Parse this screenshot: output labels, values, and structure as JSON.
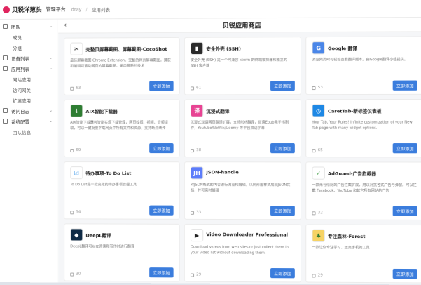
{
  "header": {
    "brand": "贝锐洋葱头",
    "platform": "管理平台",
    "breadcrumb": [
      "dray",
      "应用列表"
    ]
  },
  "sidebar": [
    {
      "label": "团队",
      "type": "group",
      "icon": "team-icon"
    },
    {
      "label": "成员",
      "type": "sub"
    },
    {
      "label": "分组",
      "type": "sub"
    },
    {
      "label": "设备列表",
      "type": "group",
      "icon": "device-icon"
    },
    {
      "label": "应用列表",
      "type": "group",
      "icon": "app-icon"
    },
    {
      "label": "网站应用",
      "type": "sub"
    },
    {
      "label": "访问网关",
      "type": "sub"
    },
    {
      "label": "扩展应用",
      "type": "sub"
    },
    {
      "label": "访问日志",
      "type": "group",
      "icon": "log-icon"
    },
    {
      "label": "系统配置",
      "type": "group",
      "icon": "settings-icon"
    },
    {
      "label": "团队信息",
      "type": "sub"
    }
  ],
  "page": {
    "title": "贝锐应用商店",
    "back": "‹"
  },
  "add_label": "立即添加",
  "apps": [
    {
      "name": "完整页屏幕截图、屏幕截图-CocoShot",
      "desc": "最佳屏幕截图 Chrome Extension。完整的网页屏幕截图。捕获和编辑可滚动网页的屏幕截图。采用最新的技术",
      "users": "63",
      "color": "#ffffff",
      "fg": "#111",
      "glyph": "✂",
      "icon": "scissors-icon"
    },
    {
      "name": "安全外壳 (SSH)",
      "desc": "安全外壳 (SSH) 是一个可兼容 xterm 的终端模拟器和独立的 SSH 客户端",
      "users": "61",
      "color": "#2b2b2b",
      "fg": "#fff",
      "glyph": "▮",
      "icon": "terminal-icon"
    },
    {
      "name": "Google 翻译",
      "desc": "浏览网页时可轻松查看翻译版本。由Google翻译小组提供。",
      "users": "53",
      "color": "#4a86e8",
      "fg": "#fff",
      "glyph": "G",
      "icon": "google-translate-icon"
    },
    {
      "name": "AIX智能下载器",
      "desc": "AIX智能下载器可智能实现下载管理，网页嗅探、视频、音频提取，可以一键批量下载网页中所有文件和资源，支持断点续传",
      "users": "69",
      "color": "#2e7d32",
      "fg": "#fff",
      "glyph": "↓",
      "icon": "download-icon"
    },
    {
      "name": "沉浸式翻译",
      "desc": "沉浸式双语网页翻译扩展，支持PDF翻译，双语Epub电子书制作，Youtube/Netflix/Udemy 等平台双语字幕",
      "users": "38",
      "color": "#e84393",
      "fg": "#fff",
      "glyph": "译",
      "icon": "immersive-translate-icon"
    },
    {
      "name": "CaretTab-新标签仪表板",
      "desc": "Your Tab, Your Rules! Infinite customization of your New Tab page with many widget options.",
      "users": "65",
      "color": "#1e88e5",
      "fg": "#fff",
      "glyph": "◷",
      "icon": "clock-icon"
    },
    {
      "name": "待办事项-To Do List",
      "desc": "To Do List是一款高效的待办事项管理工具",
      "users": "34",
      "color": "#ffffff",
      "fg": "#1e88e5",
      "glyph": "☑",
      "icon": "todo-icon"
    },
    {
      "name": "JSON-handle",
      "desc": "对JSON格式的内容进行浏览和编辑，以树形图样式展现JSON文档，并可实时编辑",
      "users": "33",
      "color": "#5c7cfa",
      "fg": "#fff",
      "glyph": "JH",
      "icon": "json-icon"
    },
    {
      "name": "AdGuard-广告拦截器",
      "desc": "一款无与伦比的广告拦截扩展，用以对抗各式广告与弹窗。可以拦截 Facebook、YouTube 和其它所有网站的广告",
      "users": "32",
      "color": "#ffffff",
      "fg": "#43a047",
      "glyph": "✓",
      "icon": "shield-icon"
    },
    {
      "name": "DeepL翻译",
      "desc": "DeepL翻译可以在阅读和写作时进行翻译",
      "users": "30",
      "color": "#0f2b46",
      "fg": "#fff",
      "glyph": "◆",
      "icon": "deepl-icon"
    },
    {
      "name": "Video Downloader Professional",
      "desc": "Download videos from web sites or just collect them in your video list without downloading them.",
      "users": "29",
      "color": "#ffffff",
      "fg": "#222",
      "glyph": "▶",
      "icon": "video-icon"
    },
    {
      "name": "专注森林-Forest",
      "desc": "一款让你专注学习、远离手机的工具",
      "users": "29",
      "color": "#f6d365",
      "fg": "#2e7d32",
      "glyph": "♣",
      "icon": "tree-icon"
    }
  ]
}
